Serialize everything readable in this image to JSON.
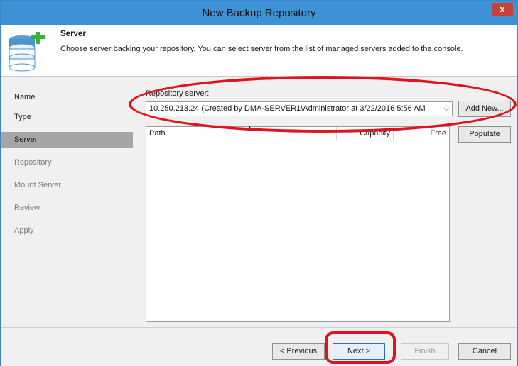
{
  "window": {
    "title": "New Backup Repository",
    "close_glyph": "x"
  },
  "header": {
    "title": "Server",
    "description": "Choose server backing your repository. You can select server from the list of managed servers added to the console.",
    "icon": "database-add-icon"
  },
  "nav": {
    "items": [
      {
        "label": "Name",
        "state": "done"
      },
      {
        "label": "Type",
        "state": "done"
      },
      {
        "label": "Server",
        "state": "active"
      },
      {
        "label": "Repository",
        "state": "pending"
      },
      {
        "label": "Mount Server",
        "state": "pending"
      },
      {
        "label": "Review",
        "state": "pending"
      },
      {
        "label": "Apply",
        "state": "pending"
      }
    ]
  },
  "server": {
    "label": "Repository server:",
    "selected": "10.250.213.24 (Created by DMA-SERVER1\\Administrator at 3/22/2016 5:56 AM",
    "add_new": "Add New...",
    "populate": "Populate"
  },
  "table": {
    "columns": [
      "Path",
      "Capacity",
      "Free"
    ],
    "rows": []
  },
  "footer": {
    "previous": "< Previous",
    "next": "Next >",
    "finish": "Finish",
    "cancel": "Cancel"
  },
  "colors": {
    "titlebar": "#3c92d4",
    "close": "#c7413b",
    "annotation": "#e0141f",
    "active_nav": "#a6a6a6"
  }
}
